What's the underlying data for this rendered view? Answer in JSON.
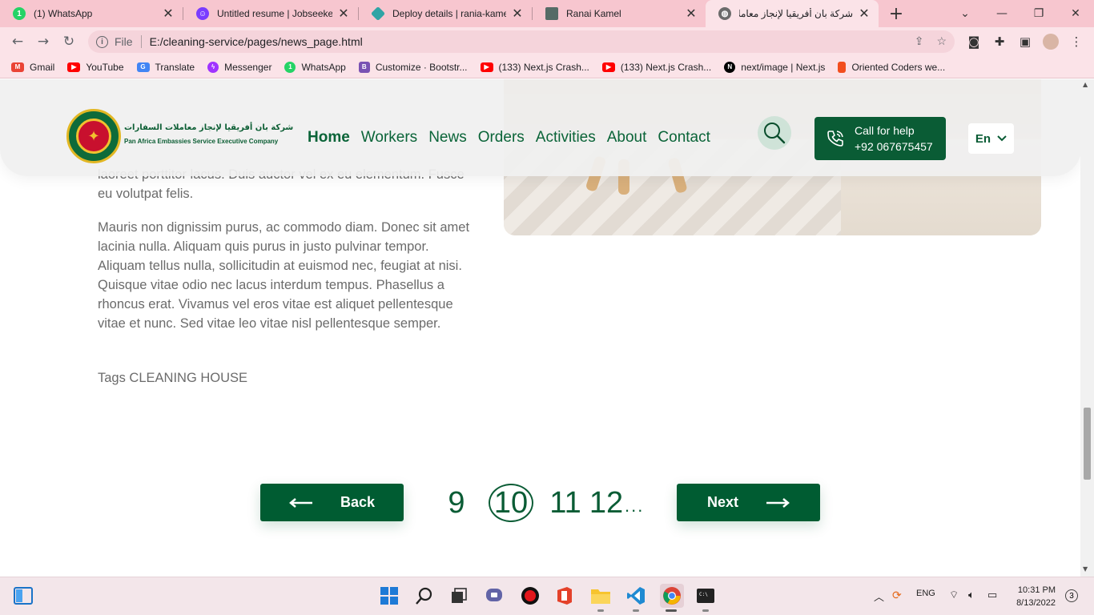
{
  "browser": {
    "tabs": [
      {
        "title": "(1) WhatsApp",
        "icon": "whatsapp-icon"
      },
      {
        "title": "Untitled resume | Jobseeker",
        "icon": "jobseeker-icon"
      },
      {
        "title": "Deploy details | rania-kamel-",
        "icon": "netlify-icon"
      },
      {
        "title": "Ranai Kamel",
        "icon": "portfolio-icon"
      },
      {
        "title": "شركة بان أفريقيا لإنجاز معاملات",
        "icon": "globe-icon"
      }
    ],
    "address": {
      "scheme": "File",
      "url": "E:/cleaning-service/pages/news_page.html"
    },
    "bookmarks": [
      {
        "label": "Gmail",
        "color": "#ea4335"
      },
      {
        "label": "YouTube",
        "color": "#ff0000"
      },
      {
        "label": "Translate",
        "color": "#4285f4"
      },
      {
        "label": "Messenger",
        "color": "#a033ff"
      },
      {
        "label": "WhatsApp",
        "color": "#25d366"
      },
      {
        "label": "Customize · Bootstr...",
        "color": "#7952b3"
      },
      {
        "label": "(133) Next.js Crash...",
        "color": "#ff0000"
      },
      {
        "label": "(133) Next.js Crash...",
        "color": "#ff0000"
      },
      {
        "label": "next/image | Next.js",
        "color": "#000000"
      },
      {
        "label": "Oriented Coders we...",
        "color": "#f24e1e"
      }
    ]
  },
  "site": {
    "logo_ar": "شركة بان أفريقيا لإنجاز معاملات السفارات",
    "logo_en": "Pan Africa Embassies Service Executive Company",
    "nav": [
      "Home",
      "Workers",
      "News",
      "Orders",
      "Activities",
      "About",
      "Contact"
    ],
    "help_line1": "Call for help",
    "help_line2": "+92 067675457",
    "language": "En",
    "accent_color": "#0a5c35"
  },
  "article": {
    "para1_partial": "laoreet porttitor lacus. Duis auctor vel ex eu elementum. Fusce eu volutpat felis.",
    "para2": "Mauris non dignissim purus, ac commodo diam. Donec sit amet lacinia nulla. Aliquam quis purus in justo pulvinar tempor. Aliquam tellus nulla, sollicitudin at euismod nec, feugiat at nisi. Quisque vitae odio nec lacus interdum tempus. Phasellus a rhoncus erat. Vivamus vel eros vitae est aliquet pellentesque vitae et nunc. Sed vitae leo vitae nisl pellentesque semper.",
    "tags": "Tags CLEANING HOUSE"
  },
  "pagination": {
    "back": "Back",
    "next": "Next",
    "pages": [
      "9",
      "10",
      "11",
      "12"
    ],
    "current": "10",
    "ellipsis": "..."
  },
  "taskbar": {
    "lang": "ENG",
    "time": "10:31 PM",
    "date": "8/13/2022",
    "notifications": "3"
  }
}
